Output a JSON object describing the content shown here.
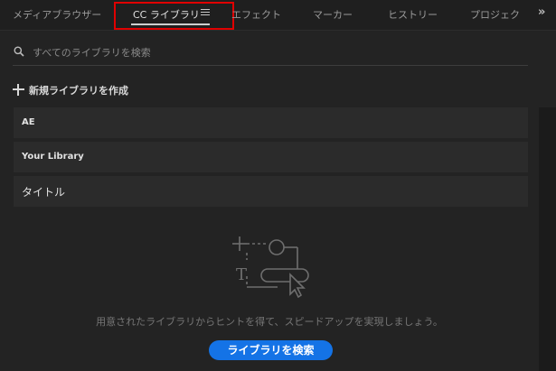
{
  "tabs": [
    {
      "label": "メディアブラウザー"
    },
    {
      "label": "CC ライブラリ"
    },
    {
      "label": "エフェクト"
    },
    {
      "label": "マーカー"
    },
    {
      "label": "ヒストリー"
    },
    {
      "label": "プロジェク"
    }
  ],
  "active_tab": "CC ライブラリ",
  "overflow_glyph": "»",
  "search": {
    "placeholder": "すべてのライブラリを検索",
    "value": ""
  },
  "create_library_label": "新規ライブラリを作成",
  "libraries": [
    {
      "name": "AE"
    },
    {
      "name": "Your Library"
    },
    {
      "name": "タイトル"
    }
  ],
  "empty_hint": "用意されたライブラリからヒントを得て、スピードアップを実現しましょう。",
  "cta_label": "ライブラリを検索",
  "icons": {
    "menu": "hamburger-menu-icon",
    "search": "magnifier-icon",
    "create": "plus-icon",
    "illustration": "library-illustration-icon"
  },
  "colors": {
    "background": "#232323",
    "tabbar": "#1f1f1f",
    "item_bg": "#2b2b2b",
    "accent_button": "#1473e6",
    "highlight_box": "#e00000"
  }
}
